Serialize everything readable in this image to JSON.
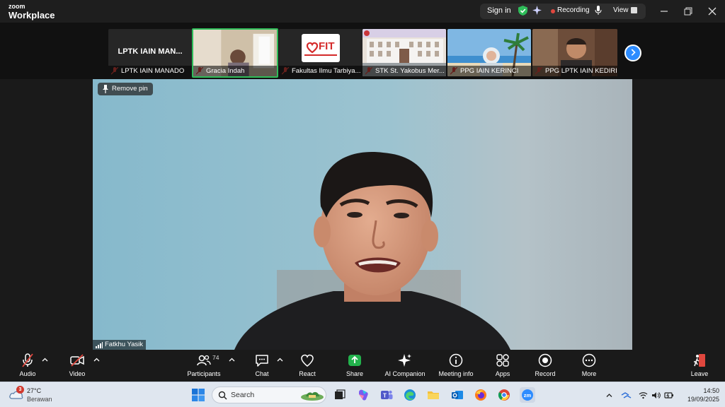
{
  "app": {
    "brand_line1": "zoom",
    "brand_line2": "Workplace"
  },
  "titlebar": {
    "sign_in": "Sign in",
    "recording": "Recording",
    "view": "View"
  },
  "thumbnails": [
    {
      "name": "LPTK IAIN MANADO",
      "tile_text": "LPTK IAIN MAN...",
      "muted": true
    },
    {
      "name": "Gracia Indah",
      "muted": true,
      "active": true
    },
    {
      "name": "Fakultas Ilmu Tarbiya...",
      "logo_text": "FIT",
      "muted": true
    },
    {
      "name": "STK St. Yakobus Mer...",
      "muted": true
    },
    {
      "name": "PPG IAIN KERINCI",
      "muted": true
    },
    {
      "name": "PPG LPTK IAIN KEDIRI",
      "muted": true
    }
  ],
  "main": {
    "remove_pin": "Remove pin",
    "speaker": "Fatkhu Yasik"
  },
  "toolbar": {
    "audio": "Audio",
    "video": "Video",
    "participants": "Participants",
    "participant_count": "74",
    "chat": "Chat",
    "react": "React",
    "share": "Share",
    "ai_companion": "AI Companion",
    "meeting_info": "Meeting info",
    "apps": "Apps",
    "record": "Record",
    "more": "More",
    "leave": "Leave"
  },
  "taskbar": {
    "weather_badge": "3",
    "temperature": "27°C",
    "weather": "Berawan",
    "search_placeholder": "Search",
    "time": "14:50",
    "date": "19/09/2025"
  },
  "colors": {
    "accent": "#2d8cff",
    "active_border": "#2fbd5a",
    "recording": "#e0473e",
    "share": "#22b24c",
    "leave": "#e0473e"
  }
}
